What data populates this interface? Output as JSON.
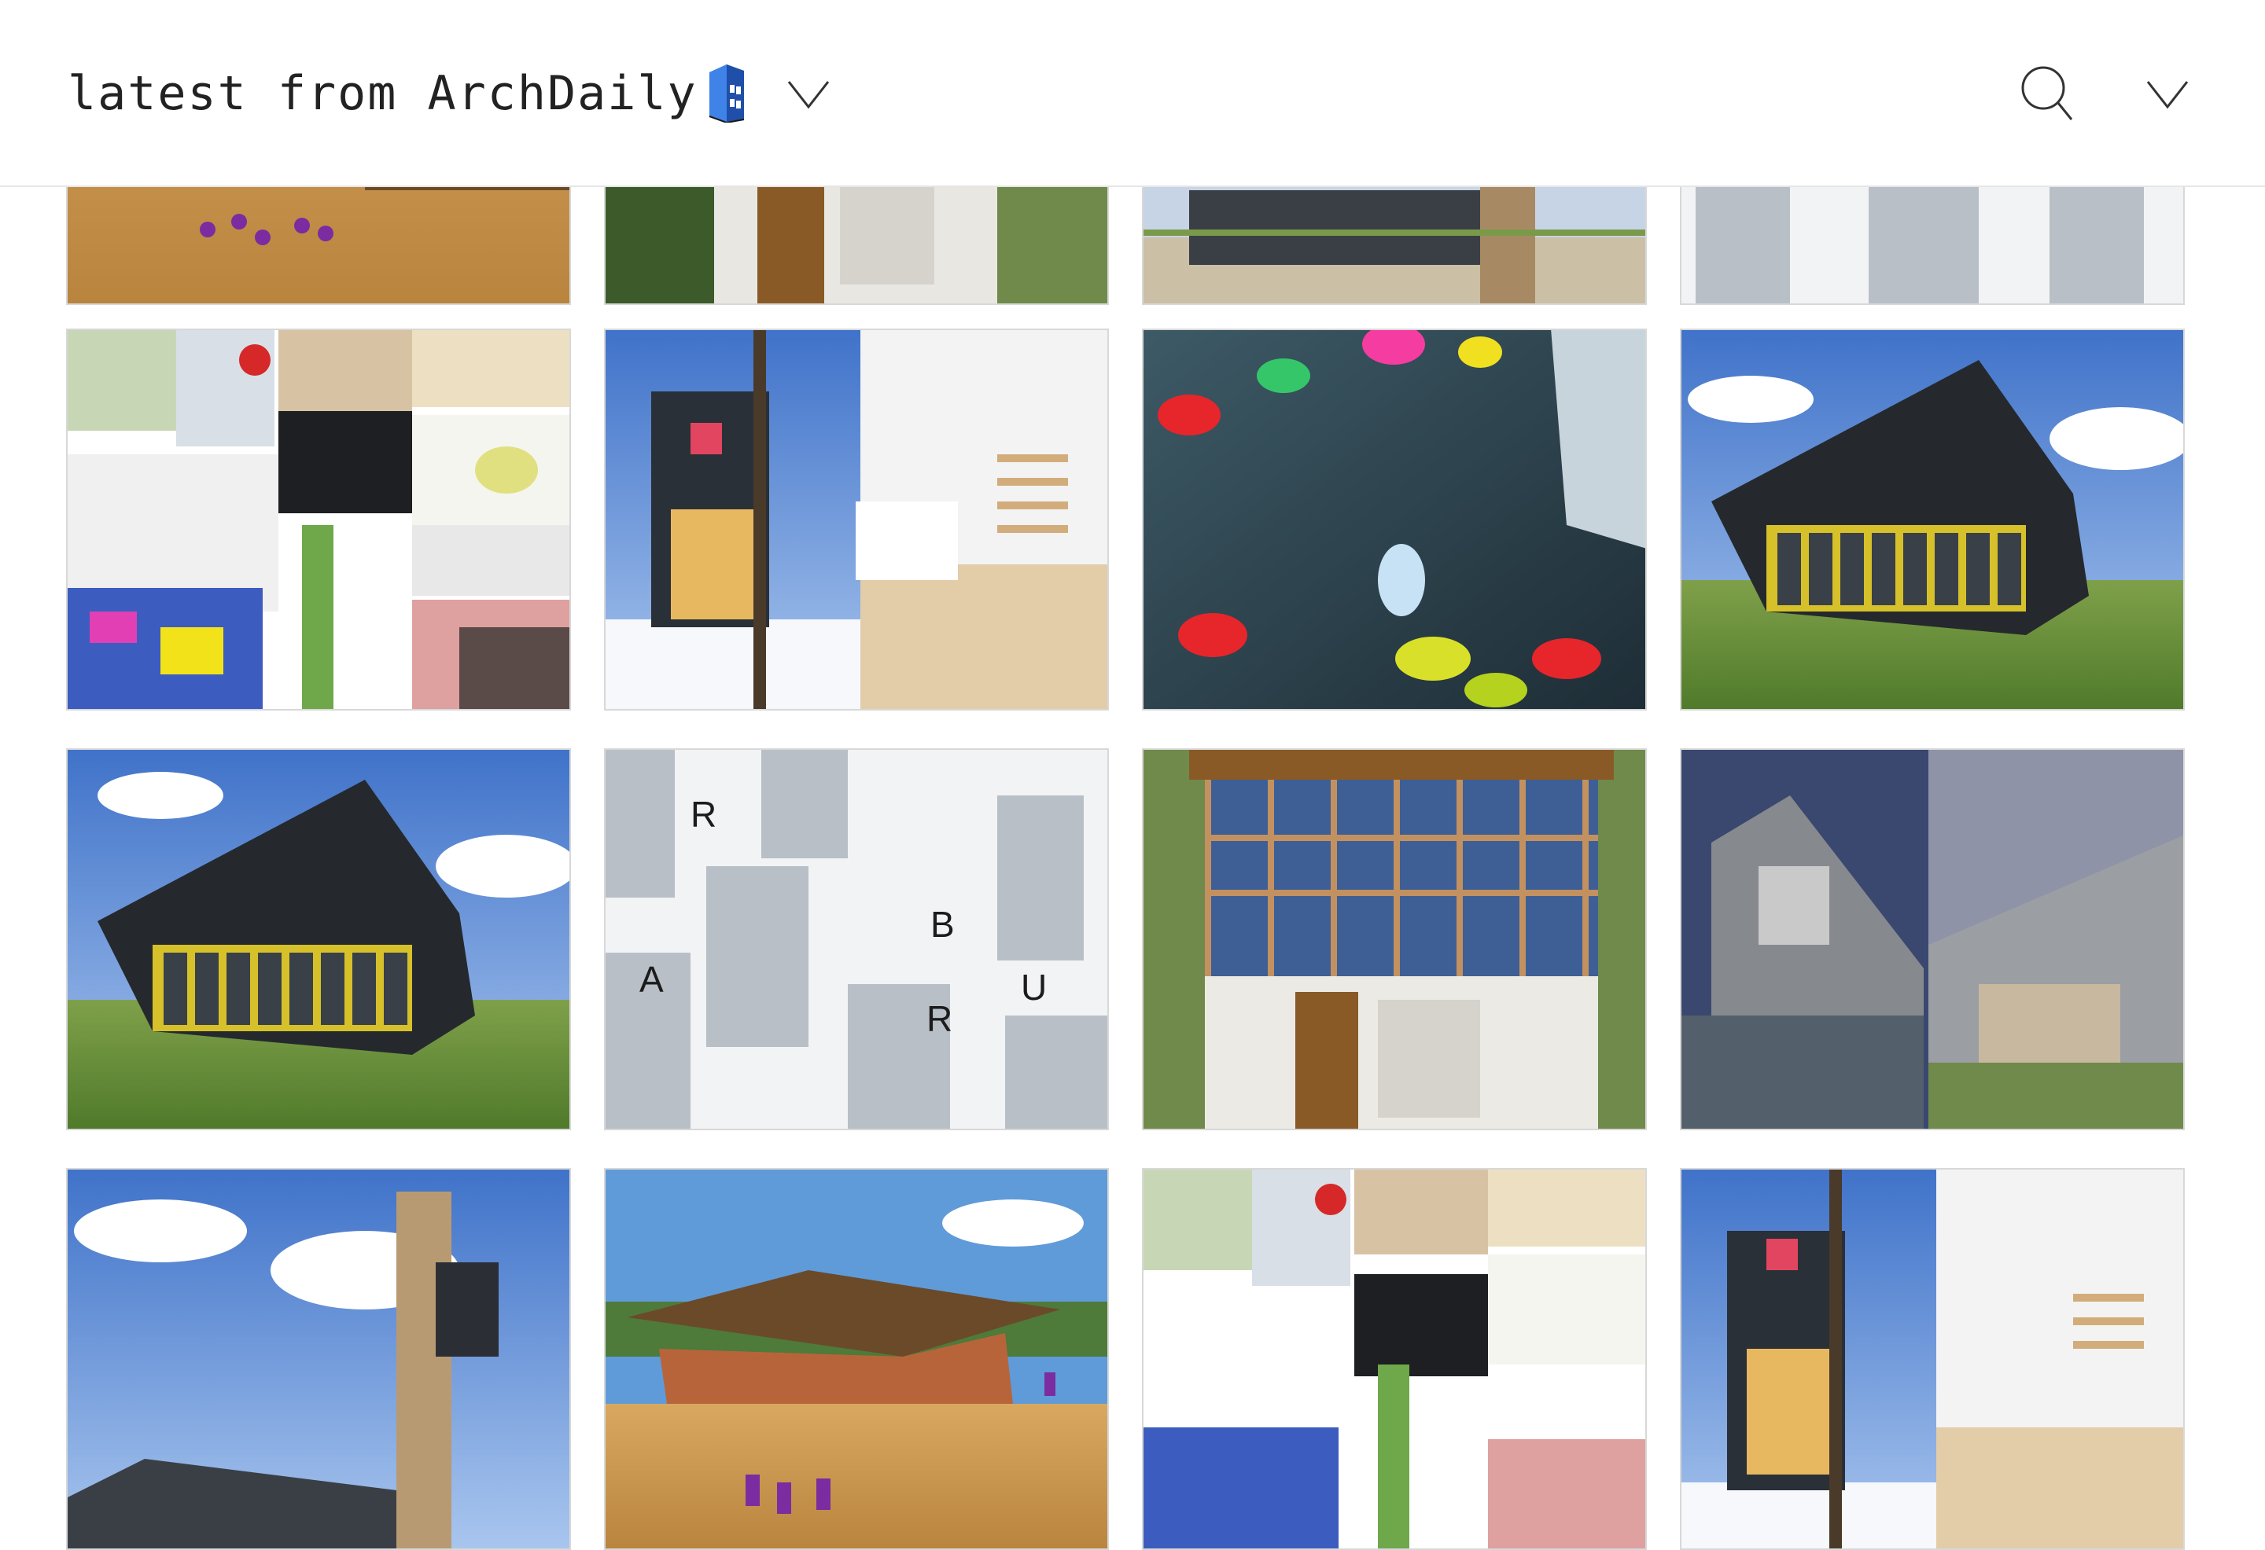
{
  "header": {
    "title": "latest from ArchDaily",
    "brand_icon": "archdaily-building-icon",
    "title_menu_icon": "chevron-down-icon",
    "search_icon": "search-icon",
    "menu_icon": "chevron-down-icon"
  },
  "colors": {
    "header_bg": "#ffffff",
    "title_text": "#222222",
    "brand_blue": "#2f6fd6",
    "divider": "#e6e6e6"
  },
  "feed": {
    "tiles": [
      {
        "subject": "school-courtyard-children"
      },
      {
        "subject": "wooden-house-facade"
      },
      {
        "subject": "concrete-pavilion-landscape"
      },
      {
        "subject": "letter-tower-models"
      },
      {
        "subject": "student-projects-collage"
      },
      {
        "subject": "treehouse-interior-split"
      },
      {
        "subject": "climbing-wall-interior"
      },
      {
        "subject": "black-building-with-yellow-windows"
      },
      {
        "subject": "black-building-with-yellow-windows"
      },
      {
        "subject": "letter-tower-models"
      },
      {
        "subject": "wooden-house-facade"
      },
      {
        "subject": "brick-house-split"
      },
      {
        "subject": "timber-lookout-tower"
      },
      {
        "subject": "brick-school-roof-canopy"
      },
      {
        "subject": "student-projects-collage"
      },
      {
        "subject": "treehouse-interior-split"
      }
    ]
  }
}
